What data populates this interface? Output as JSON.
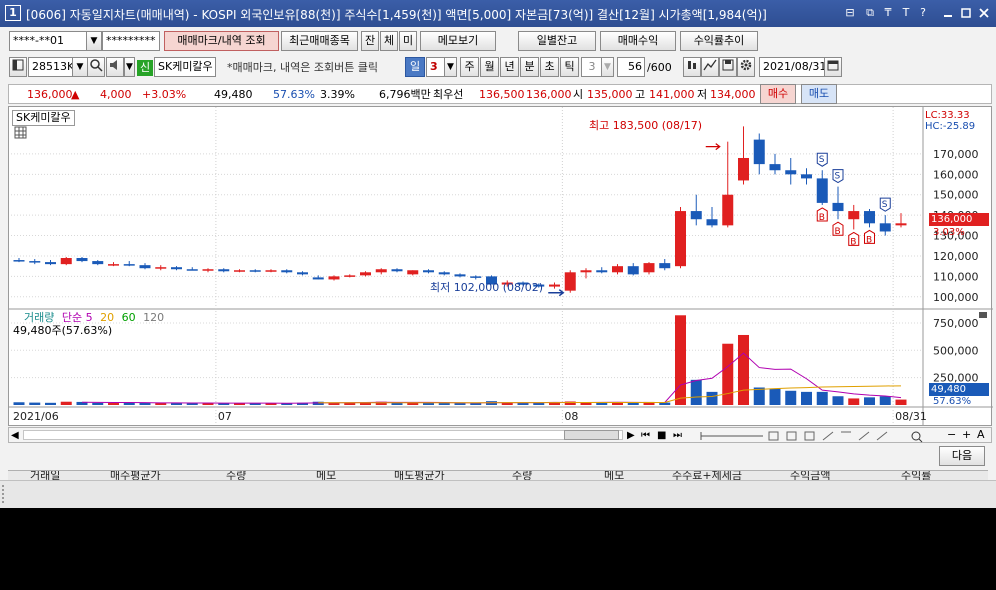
{
  "window": {
    "icon_label": "1",
    "title": "[0606] 자동일지차트(매매내역) - KOSPI 외국인보유[88(천)] 주식수[1,459(천)] 액면[5,000] 자본금[73(억)] 결산[12월] 시가총액[1,984(억)]",
    "title_buttons": [
      "⊟",
      "⧉",
      "₸",
      "T",
      "?"
    ]
  },
  "toolbar1": {
    "account": "****-**01",
    "password": "*********",
    "trade_mark_btn": "매매마크/내역 조회",
    "recent_btn": "최근매매종목",
    "jan": "잔",
    "che": "체",
    "mi": "미",
    "memo_btn": "메모보기",
    "daily_balance_btn": "일별잔고",
    "trade_profit_btn": "매매수익",
    "profit_trend_btn": "수익률추이"
  },
  "toolbar2": {
    "code": "28513K",
    "stock_badge": "신",
    "stock_name": "SK케미칼우",
    "notice": "*매매마크, 내역은 조회버튼 클릭",
    "period_day": "일",
    "period_value": "3",
    "period_week": "주",
    "period_month": "월",
    "period_year": "년",
    "period_min": "분",
    "period_sec": "초",
    "period_tick": "틱",
    "tick_value": "3",
    "count": "56",
    "count_max": "/600",
    "date": "2021/08/31"
  },
  "quote": {
    "price": "136,000",
    "change_arrow": "▲",
    "change": "4,000",
    "change_pct": "+3.03%",
    "volume": "49,480",
    "vol_ratio": "57.63%",
    "turnover": "3.39%",
    "amount": "6,796백만",
    "best_label": "최우선",
    "ask": "136,500",
    "bid": "136,000",
    "open_label": "시",
    "open": "135,000",
    "high_label": "고",
    "high": "141,000",
    "low_label": "저",
    "low": "134,000",
    "buy_btn": "매수",
    "sell_btn": "매도"
  },
  "chart_data": {
    "type": "candlestick",
    "title": "SK케미칼우",
    "lc_label": "LC:33.33",
    "hc_label": "HC:-25.89",
    "y_ticks": [
      100000,
      110000,
      120000,
      130000,
      140000,
      150000,
      160000,
      170000
    ],
    "y_tick_labels": [
      "100,000",
      "110,000",
      "120,000",
      "130,000",
      "140,000",
      "150,000",
      "160,000",
      "170,000"
    ],
    "ylim": [
      95000,
      192000
    ],
    "current_price_label": "136,000",
    "current_pct_label": "3.03%",
    "high_annotation": "최고 183,500 (08/17)",
    "low_annotation": "최저 102,000 (08/02)",
    "high_index": 45,
    "low_index": 35,
    "x_labels": [
      {
        "label": "2021/06",
        "index": 0
      },
      {
        "label": "07",
        "index": 13
      },
      {
        "label": "08",
        "index": 35
      },
      {
        "label": "08/31",
        "index": 56
      }
    ],
    "candles": [
      {
        "o": 118000,
        "h": 119000,
        "l": 117000,
        "c": 117500
      },
      {
        "o": 117500,
        "h": 118500,
        "l": 116000,
        "c": 117000
      },
      {
        "o": 117000,
        "h": 118000,
        "l": 115500,
        "c": 116000
      },
      {
        "o": 116000,
        "h": 119500,
        "l": 115500,
        "c": 119000
      },
      {
        "o": 119000,
        "h": 119500,
        "l": 117000,
        "c": 117500
      },
      {
        "o": 117500,
        "h": 118000,
        "l": 115500,
        "c": 116000
      },
      {
        "o": 116000,
        "h": 117000,
        "l": 115000,
        "c": 116000
      },
      {
        "o": 116000,
        "h": 117500,
        "l": 115000,
        "c": 115500
      },
      {
        "o": 115500,
        "h": 116500,
        "l": 113500,
        "c": 114000
      },
      {
        "o": 114000,
        "h": 115500,
        "l": 113000,
        "c": 114500
      },
      {
        "o": 114500,
        "h": 115000,
        "l": 113000,
        "c": 113500
      },
      {
        "o": 113500,
        "h": 114500,
        "l": 113000,
        "c": 113000
      },
      {
        "o": 113000,
        "h": 114000,
        "l": 112000,
        "c": 113500
      },
      {
        "o": 113500,
        "h": 114000,
        "l": 112000,
        "c": 112500
      },
      {
        "o": 112500,
        "h": 113500,
        "l": 112000,
        "c": 113000
      },
      {
        "o": 113000,
        "h": 113500,
        "l": 112000,
        "c": 112500
      },
      {
        "o": 112500,
        "h": 113500,
        "l": 112000,
        "c": 113000
      },
      {
        "o": 113000,
        "h": 113500,
        "l": 111500,
        "c": 112000
      },
      {
        "o": 112000,
        "h": 112500,
        "l": 110500,
        "c": 111000
      },
      {
        "o": 109500,
        "h": 110500,
        "l": 108500,
        "c": 108500
      },
      {
        "o": 108500,
        "h": 110500,
        "l": 108000,
        "c": 110000
      },
      {
        "o": 110000,
        "h": 111000,
        "l": 109500,
        "c": 110500
      },
      {
        "o": 110500,
        "h": 112500,
        "l": 110000,
        "c": 112000
      },
      {
        "o": 112000,
        "h": 114000,
        "l": 111000,
        "c": 113500
      },
      {
        "o": 113500,
        "h": 114000,
        "l": 112000,
        "c": 112500
      },
      {
        "o": 111000,
        "h": 113000,
        "l": 110500,
        "c": 113000
      },
      {
        "o": 113000,
        "h": 113500,
        "l": 111500,
        "c": 112000
      },
      {
        "o": 112000,
        "h": 112500,
        "l": 110500,
        "c": 111000
      },
      {
        "o": 111000,
        "h": 111500,
        "l": 109500,
        "c": 110000
      },
      {
        "o": 110000,
        "h": 110500,
        "l": 108500,
        "c": 109500
      },
      {
        "o": 110000,
        "h": 110500,
        "l": 106000,
        "c": 106000
      },
      {
        "o": 106000,
        "h": 108000,
        "l": 105000,
        "c": 107000
      },
      {
        "o": 107000,
        "h": 107500,
        "l": 105500,
        "c": 106000
      },
      {
        "o": 106000,
        "h": 106500,
        "l": 104500,
        "c": 105000
      },
      {
        "o": 105000,
        "h": 107000,
        "l": 104000,
        "c": 106000
      },
      {
        "o": 103000,
        "h": 113000,
        "l": 102000,
        "c": 112000
      },
      {
        "o": 112000,
        "h": 114000,
        "l": 109000,
        "c": 113000
      },
      {
        "o": 113000,
        "h": 114500,
        "l": 111500,
        "c": 112000
      },
      {
        "o": 112000,
        "h": 116000,
        "l": 111000,
        "c": 115000
      },
      {
        "o": 115000,
        "h": 116500,
        "l": 110500,
        "c": 111000
      },
      {
        "o": 112000,
        "h": 117000,
        "l": 111000,
        "c": 116500
      },
      {
        "o": 116500,
        "h": 118500,
        "l": 113000,
        "c": 114000
      },
      {
        "o": 115000,
        "h": 144000,
        "l": 114000,
        "c": 142000
      },
      {
        "o": 142000,
        "h": 150000,
        "l": 135000,
        "c": 138000
      },
      {
        "o": 138000,
        "h": 144000,
        "l": 134000,
        "c": 135000
      },
      {
        "o": 135000,
        "h": 176000,
        "l": 134000,
        "c": 150000
      },
      {
        "o": 157000,
        "h": 183500,
        "l": 155000,
        "c": 168000
      },
      {
        "o": 177000,
        "h": 180000,
        "l": 160000,
        "c": 165000
      },
      {
        "o": 165000,
        "h": 170000,
        "l": 160000,
        "c": 162000
      },
      {
        "o": 162000,
        "h": 168000,
        "l": 155000,
        "c": 160000
      },
      {
        "o": 160000,
        "h": 163000,
        "l": 155000,
        "c": 158000
      },
      {
        "o": 158000,
        "h": 162000,
        "l": 145000,
        "c": 146000
      },
      {
        "o": 146000,
        "h": 154000,
        "l": 138000,
        "c": 142000
      },
      {
        "o": 138000,
        "h": 145000,
        "l": 133000,
        "c": 142000
      },
      {
        "o": 142000,
        "h": 143000,
        "l": 134000,
        "c": 136000
      },
      {
        "o": 136000,
        "h": 140000,
        "l": 130000,
        "c": 132000
      },
      {
        "o": 135000,
        "h": 141000,
        "l": 134000,
        "c": 136000
      }
    ],
    "trade_marks": [
      {
        "index": 51,
        "type": "S"
      },
      {
        "index": 51,
        "type": "B"
      },
      {
        "index": 52,
        "type": "S"
      },
      {
        "index": 52,
        "type": "B"
      },
      {
        "index": 53,
        "type": "B"
      },
      {
        "index": 54,
        "type": "B"
      },
      {
        "index": 55,
        "type": "S"
      }
    ],
    "volume": {
      "label": "거래량",
      "ma_label": "단순",
      "ma_periods": [
        "5",
        "20",
        "60",
        "120"
      ],
      "ma_colors": [
        "#b000b0",
        "#e0a000",
        "#00a000",
        "#7a7a7a"
      ],
      "current_label": "49,480주(57.63%)",
      "y_ticks": [
        250000,
        500000,
        750000
      ],
      "y_tick_labels": [
        "250,000",
        "500,000",
        "750,000"
      ],
      "ylim": [
        0,
        850000
      ],
      "current_value_label": "49,480",
      "current_pct_label": "57.63%",
      "values": [
        25000,
        22000,
        20000,
        30000,
        28000,
        20000,
        18000,
        20000,
        22000,
        18000,
        18000,
        16000,
        18000,
        17000,
        16000,
        16000,
        16000,
        17000,
        20000,
        30000,
        22000,
        20000,
        25000,
        30000,
        22000,
        25000,
        20000,
        18000,
        18000,
        18000,
        35000,
        20000,
        18000,
        20000,
        25000,
        32000,
        22000,
        20000,
        25000,
        20000,
        28000,
        22000,
        820000,
        230000,
        120000,
        560000,
        640000,
        160000,
        150000,
        130000,
        120000,
        120000,
        80000,
        60000,
        70000,
        80000,
        49480
      ]
    }
  },
  "scroll": {
    "zoom_minus": "−",
    "zoom_plus": "+",
    "text_tool": "A"
  },
  "next_btn": "다음",
  "grid_headers": [
    "거래일",
    "매수평균가",
    "수량",
    "메모",
    "매도평균가",
    "수량",
    "메모",
    "수수료+제세금",
    "수익금액",
    "수익률"
  ]
}
